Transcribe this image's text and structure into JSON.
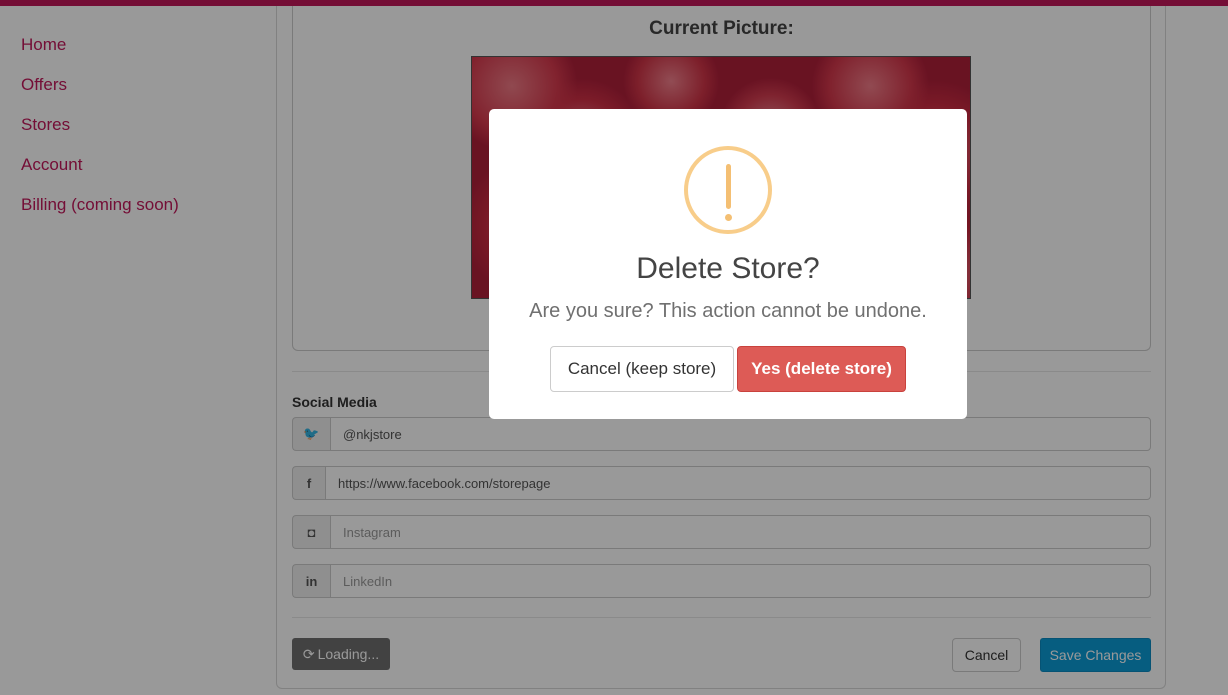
{
  "sidebar": {
    "items": [
      {
        "label": "Home",
        "icon": "none"
      },
      {
        "label": "Offers",
        "icon": "none"
      },
      {
        "label": "Stores",
        "icon": "none"
      },
      {
        "label": "Account",
        "icon": "none"
      },
      {
        "label": "Billing (coming soon)",
        "icon": "none"
      }
    ]
  },
  "picture": {
    "title": "Current Picture:"
  },
  "social": {
    "title": "Social Media",
    "fields": [
      {
        "icon": "twitter-icon",
        "glyph": "🐦",
        "value": "@nkjstore",
        "placeholder": "Twitter"
      },
      {
        "icon": "facebook-icon",
        "glyph": "f",
        "value": "https://www.facebook.com/storepage",
        "placeholder": "Facebook"
      },
      {
        "icon": "instagram-icon",
        "glyph": "◘",
        "value": "",
        "placeholder": "Instagram"
      },
      {
        "icon": "linkedin-icon",
        "glyph": "in",
        "value": "",
        "placeholder": "LinkedIn"
      }
    ]
  },
  "actions": {
    "loading_label": "Loading...",
    "cancel_label": "Cancel",
    "save_label": "Save Changes"
  },
  "modal": {
    "title": "Delete Store?",
    "text": "Are you sure? This action cannot be undone.",
    "cancel_label": "Cancel (keep store)",
    "confirm_label": "Yes (delete store)"
  },
  "colors": {
    "brand": "#c2185b",
    "primary": "#0a9bd6",
    "danger": "#dd5b56",
    "warning": "#f8cd8a"
  }
}
